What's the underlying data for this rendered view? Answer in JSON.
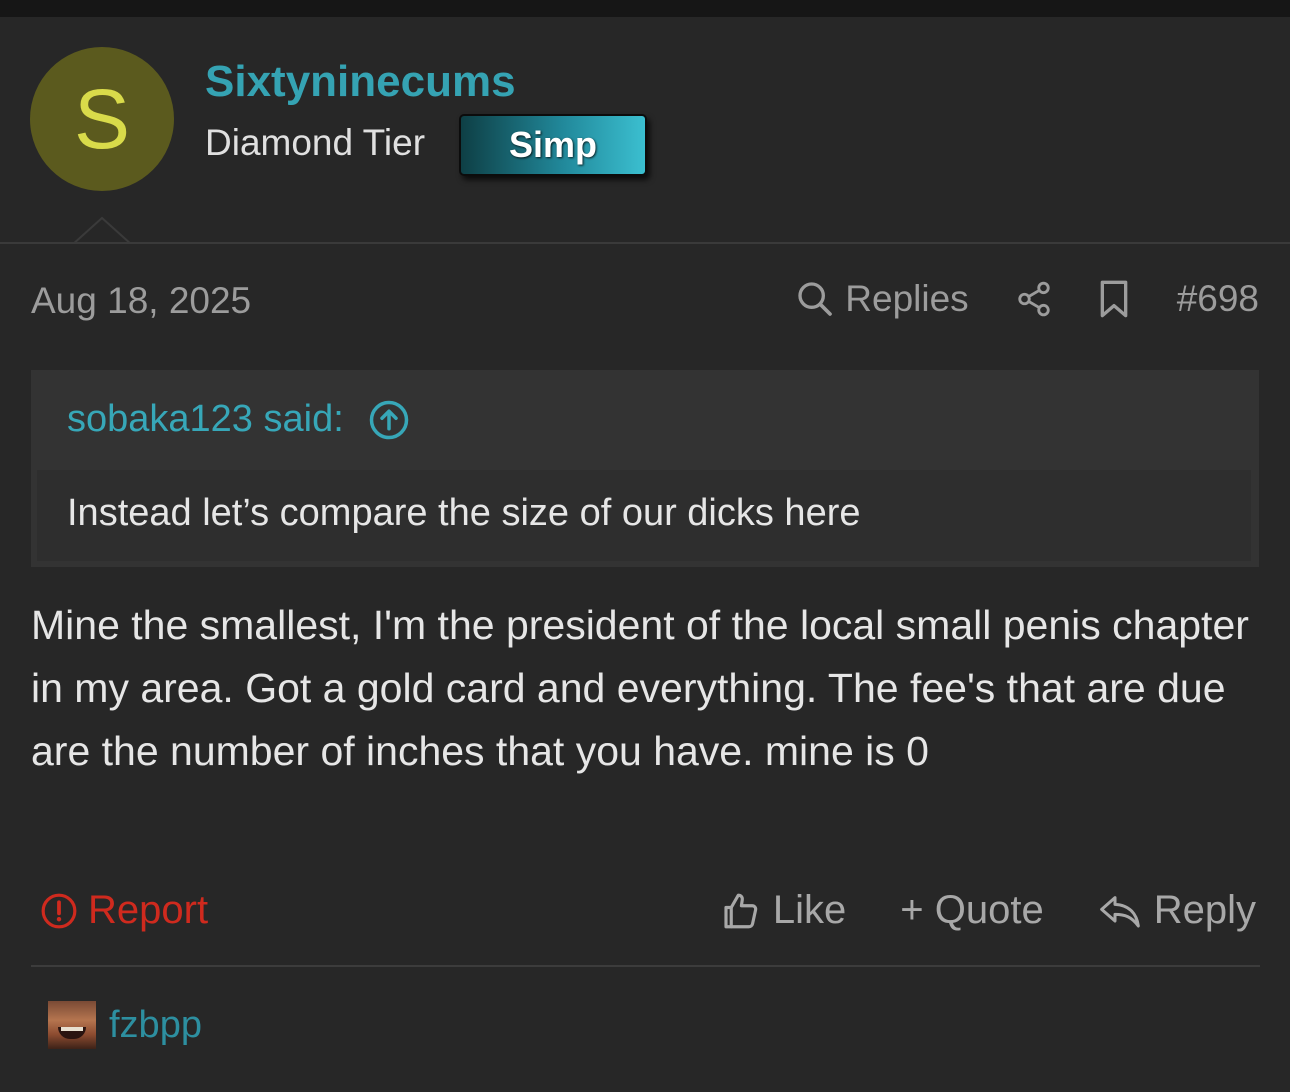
{
  "post": {
    "author": {
      "avatar_letter": "S",
      "username": "Sixtyninecums",
      "tier": "Diamond Tier",
      "badge": "Simp"
    },
    "date": "Aug 18, 2025",
    "replies_label": "Replies",
    "post_number": "#698",
    "quote": {
      "header": "sobaka123 said:",
      "text": "Instead let’s compare the size of our dicks here"
    },
    "body": "Mine the smallest, I'm the president of the local small penis chapter in my area. Got a gold card and everything. The fee's that are due are the number of inches that you have. mine is 0",
    "actions": {
      "report": "Report",
      "like": "Like",
      "quote": "+ Quote",
      "reply": "Reply"
    },
    "liked_by": "fzbpp"
  },
  "colors": {
    "background": "#272727",
    "accent": "#35a3b3",
    "report": "#cf2a1e",
    "avatar_bg": "#5b5a1e"
  },
  "icons": [
    "search-icon",
    "share-icon",
    "bookmark-icon",
    "arrow-up-circle-icon",
    "alert-circle-icon",
    "thumbs-up-icon",
    "reply-arrow-icon"
  ]
}
